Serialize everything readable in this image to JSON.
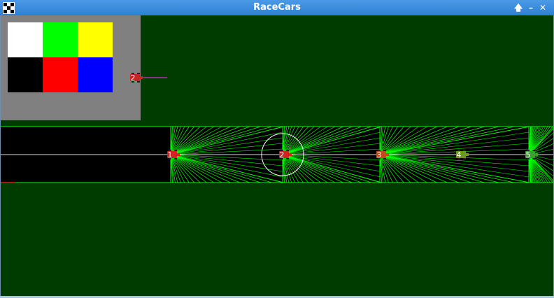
{
  "window": {
    "title": "RaceCars",
    "icon": "racecars-app-icon",
    "controls": [
      {
        "name": "maximize-button",
        "glyph": "🡅"
      },
      {
        "name": "minimize-button",
        "glyph": "–"
      },
      {
        "name": "close-button",
        "glyph": "✕"
      }
    ]
  },
  "palette": {
    "background": "#808080",
    "swatches": [
      "#ffffff",
      "#00ff00",
      "#ffff00",
      "#000000",
      "#ff0000",
      "#0000ff"
    ]
  },
  "preview_car": {
    "label": "2",
    "color": "#cc2222"
  },
  "track": {
    "background": "#000000",
    "field_color": "#003c00",
    "ray_color": "#00ff00",
    "centerline_color": "#dddddd"
  },
  "cars": [
    {
      "label": "1",
      "color": "#d42020"
    },
    {
      "label": "2",
      "color": "#d42020",
      "selected": true
    },
    {
      "label": "3",
      "color": "#c04a1a"
    },
    {
      "label": "4",
      "color": "#6a9a1a"
    },
    {
      "label": "5",
      "color": "#3aa030"
    }
  ]
}
